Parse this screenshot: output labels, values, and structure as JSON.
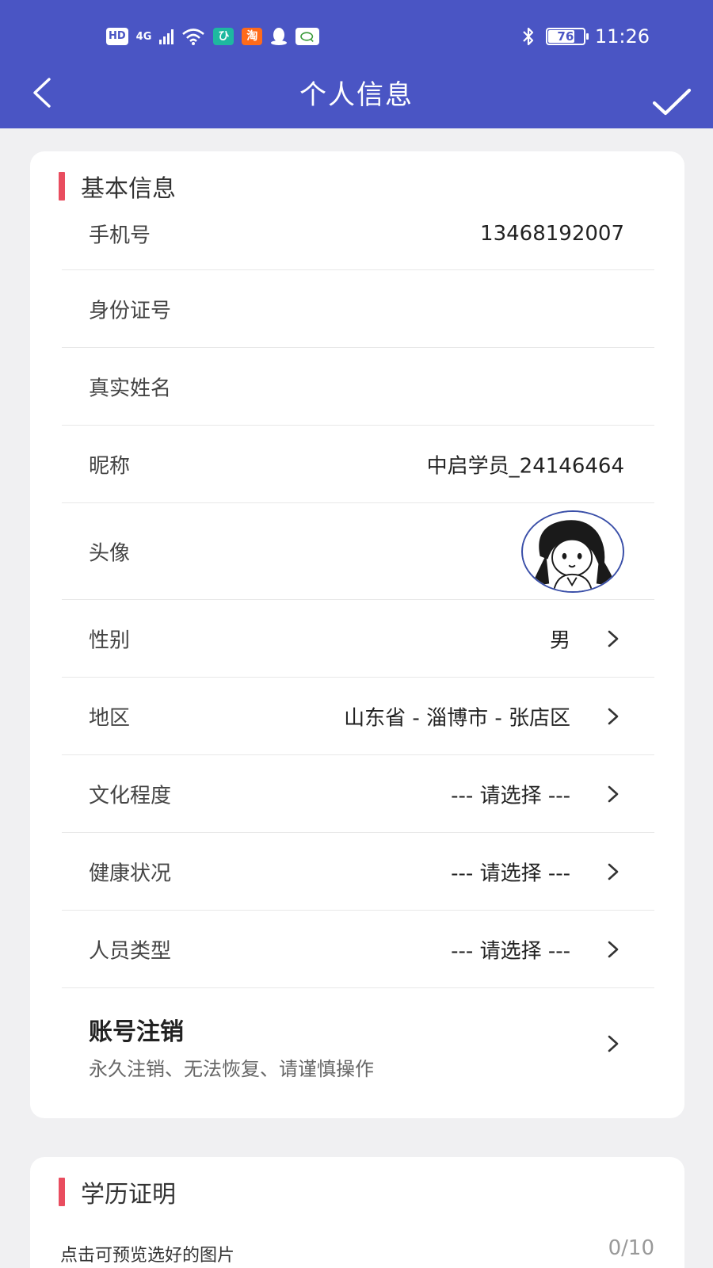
{
  "status_bar": {
    "hd": "HD",
    "network": "4G",
    "mi_app": "ひ",
    "taobao_app": "淘",
    "battery": "76",
    "battery_level": 0.76,
    "time": "11:26"
  },
  "nav": {
    "title": "个人信息"
  },
  "basic": {
    "section_title": "基本信息",
    "fields": {
      "phone": {
        "label": "手机号",
        "value": "13468192007"
      },
      "id_number": {
        "label": "身份证号",
        "value": ""
      },
      "real_name": {
        "label": "真实姓名",
        "value": ""
      },
      "nickname": {
        "label": "昵称",
        "value": "中启学员_24146464"
      },
      "avatar": {
        "label": "头像"
      },
      "gender": {
        "label": "性别",
        "value": "男"
      },
      "region": {
        "label": "地区",
        "value": "山东省 - 淄博市 - 张店区"
      },
      "education": {
        "label": "文化程度",
        "value": "--- 请选择 ---"
      },
      "health": {
        "label": "健康状况",
        "value": "--- 请选择 ---"
      },
      "person_type": {
        "label": "人员类型",
        "value": "--- 请选择 ---"
      }
    },
    "account_cancel": {
      "title": "账号注销",
      "subtitle": "永久注销、无法恢复、请谨慎操作"
    }
  },
  "education_proof": {
    "section_title": "学历证明",
    "hint": "点击可预览选好的图片",
    "count": "0/10"
  },
  "colors": {
    "header": "#4a55c4",
    "accent_bar": "#e94d5f",
    "background": "#f0f0f2"
  }
}
